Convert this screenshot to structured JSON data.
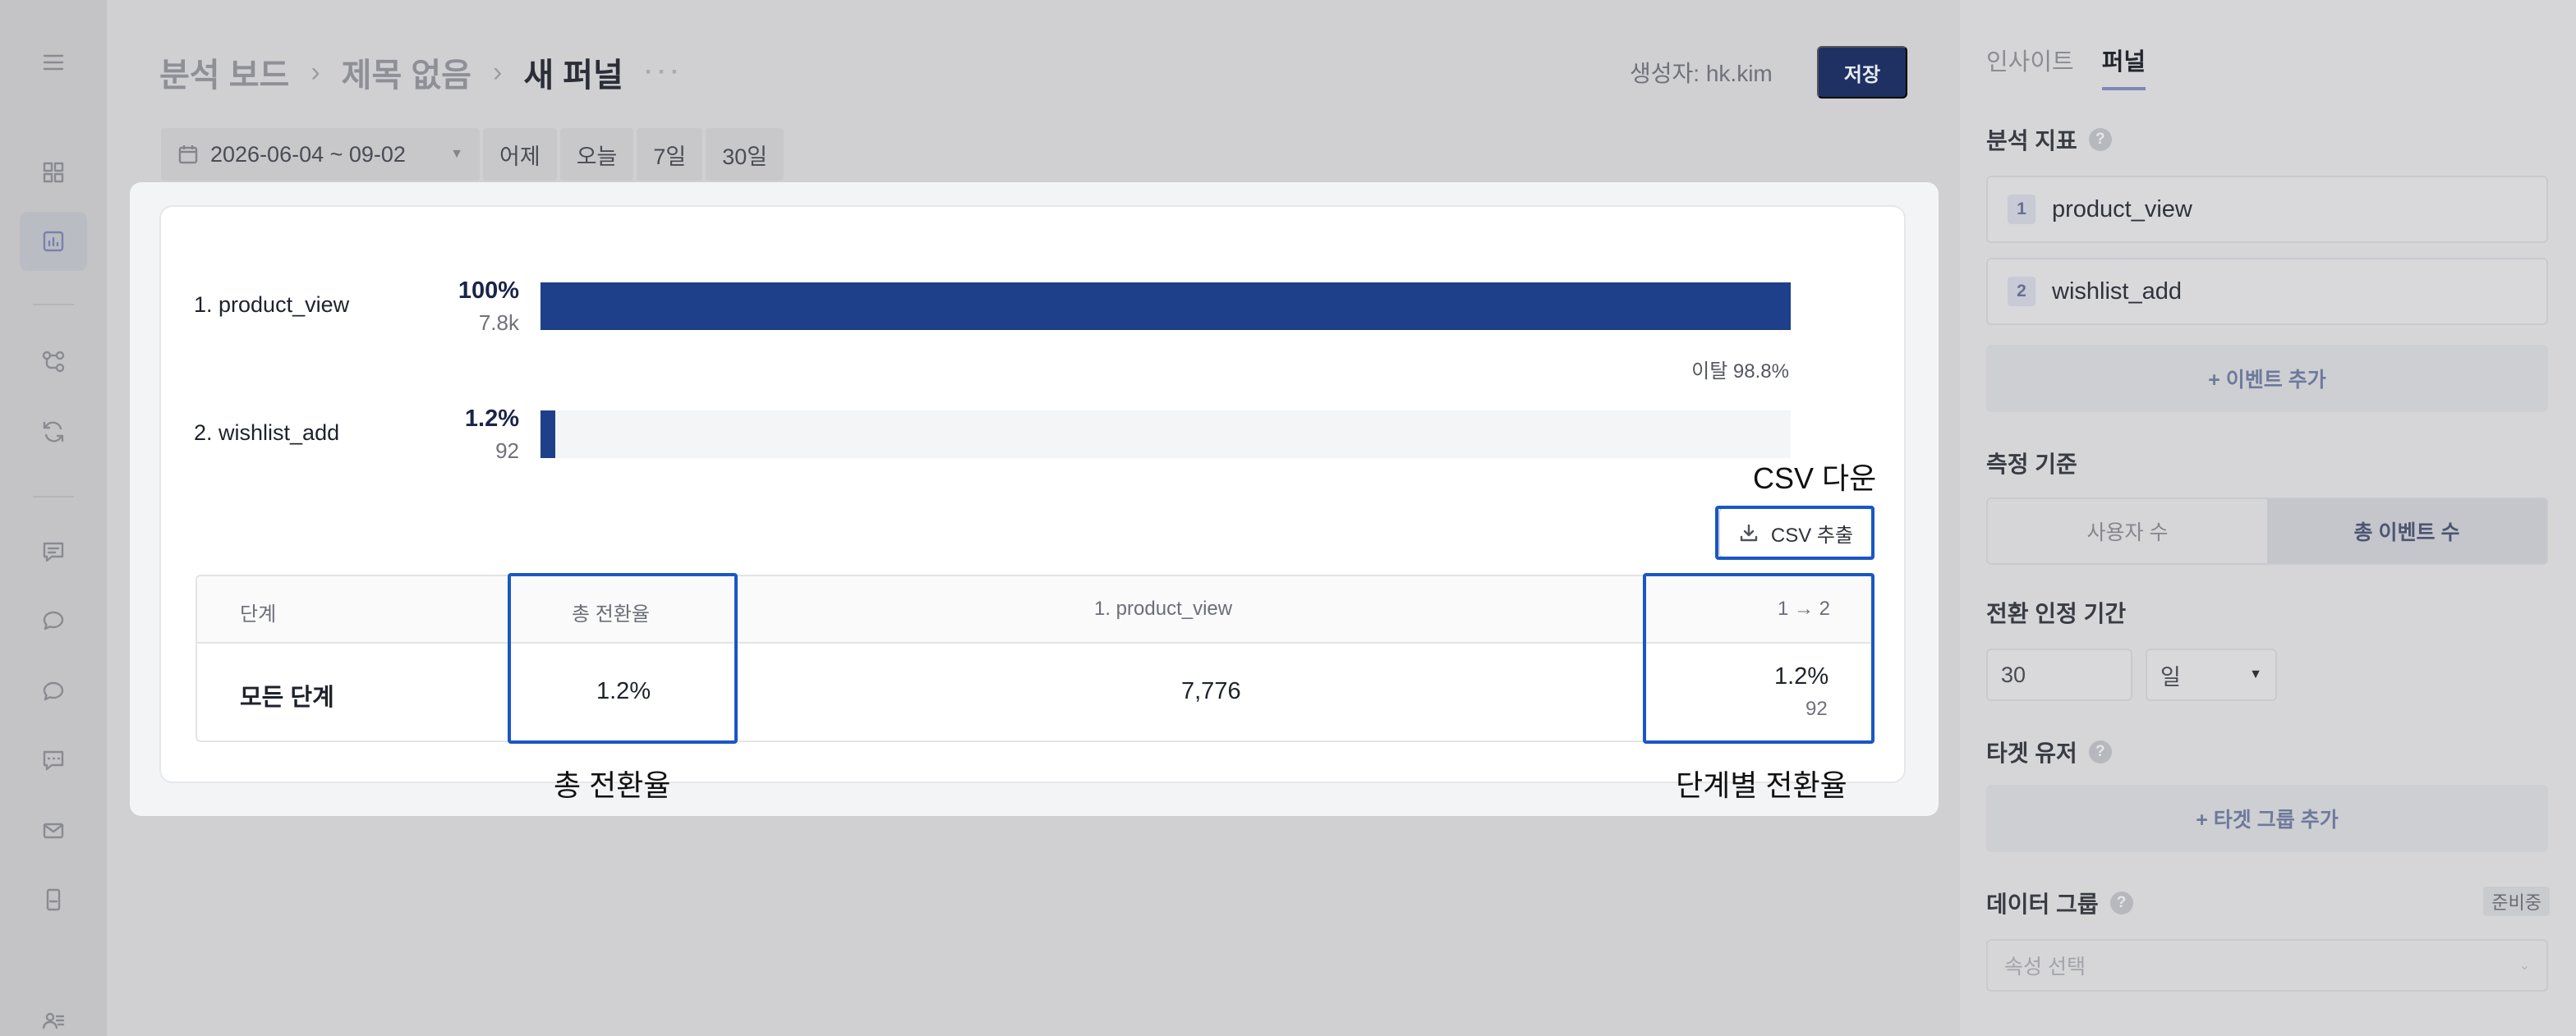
{
  "rail": {
    "icons": [
      "menu-icon",
      "dashboard-icon",
      "chart-icon",
      "flow-icon",
      "refresh-icon",
      "message-icon",
      "chat-bubble-icon",
      "chat-bubble-2-icon",
      "comment-icon",
      "mail-icon",
      "mobile-icon",
      "users-icon"
    ]
  },
  "header": {
    "breadcrumb": [
      "분석 보드",
      "제목 없음",
      "새 퍼널"
    ],
    "more": "···",
    "creator_label": "생성자:",
    "creator_name": "hk.kim",
    "save": "저장"
  },
  "datebar": {
    "range": "2026-06-04 ~ 09-02",
    "presets": [
      "어제",
      "오늘",
      "7일",
      "30일"
    ]
  },
  "funnel": {
    "steps": [
      {
        "label": "1. product_view",
        "percent": "100%",
        "count": "7.8k",
        "fraction": 1.0
      },
      {
        "label": "2. wishlist_add",
        "percent": "1.2%",
        "count": "92",
        "fraction": 0.012
      }
    ],
    "dropoff": "이탈 98.8%",
    "csv_button": "CSV 추출"
  },
  "table": {
    "headers": [
      "단계",
      "총 전환율",
      "1. product_view",
      "1 → 2"
    ],
    "row": {
      "step": "모든 단계",
      "total_rate": "1.2%",
      "step1": "7,776",
      "step12_rate": "1.2%",
      "step12_count": "92"
    }
  },
  "annotations": {
    "csv": "CSV 다운",
    "total": "총 전환율",
    "stepwise": "단계별 전환율"
  },
  "sidebar": {
    "tabs": [
      "인사이트",
      "퍼널"
    ],
    "metrics_title": "분석 지표",
    "events": [
      {
        "n": "1",
        "name": "product_view"
      },
      {
        "n": "2",
        "name": "wishlist_add"
      }
    ],
    "add_event": "+ 이벤트 추가",
    "measure_title": "측정 기준",
    "measure_options": [
      "사용자 수",
      "총 이벤트 수"
    ],
    "window_title": "전환 인정 기간",
    "window_value": "30",
    "window_unit": "일",
    "target_title": "타겟 유저",
    "add_target": "+ 타겟 그룹 추가",
    "group_title": "데이터 그룹",
    "group_badge": "준비중",
    "group_placeholder": "속성 선택"
  },
  "colors": {
    "accent": "#1e3f8a",
    "highlight": "#1a57c6",
    "save": "#1e3162"
  }
}
